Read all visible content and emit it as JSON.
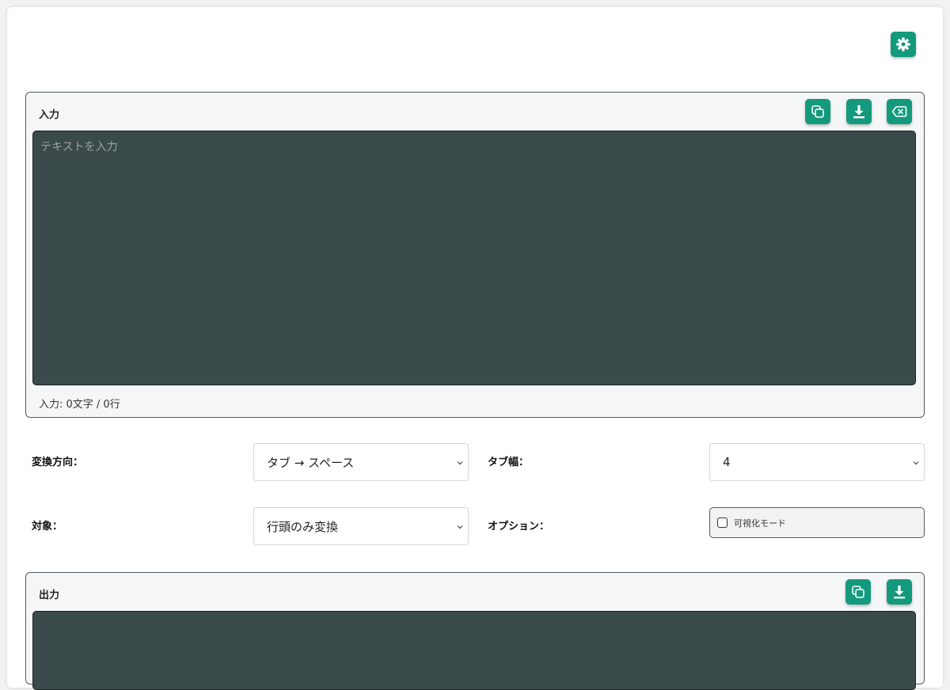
{
  "input_panel": {
    "title": "入力",
    "placeholder": "テキストを入力",
    "counter": "入力: 0文字 / 0行"
  },
  "output_panel": {
    "title": "出力"
  },
  "form": {
    "direction_label": "変換方向：",
    "direction_value": "タブ → スペース",
    "tab_width_label": "タブ幅：",
    "tab_width_value": "4",
    "target_label": "対象：",
    "target_value": "行頭のみ変換",
    "option_label": "オプション：",
    "visualize_label": "可視化モード",
    "visualize_checked": false
  },
  "icons": {
    "settings": "gear-icon",
    "copy": "copy-icon",
    "download": "download-icon",
    "clear": "backspace-icon",
    "chevron": "chevron-down-icon"
  },
  "colors": {
    "accent": "#139a7d",
    "editor_bg": "#3a4a4a",
    "panel_bg": "#f5f6f7"
  }
}
